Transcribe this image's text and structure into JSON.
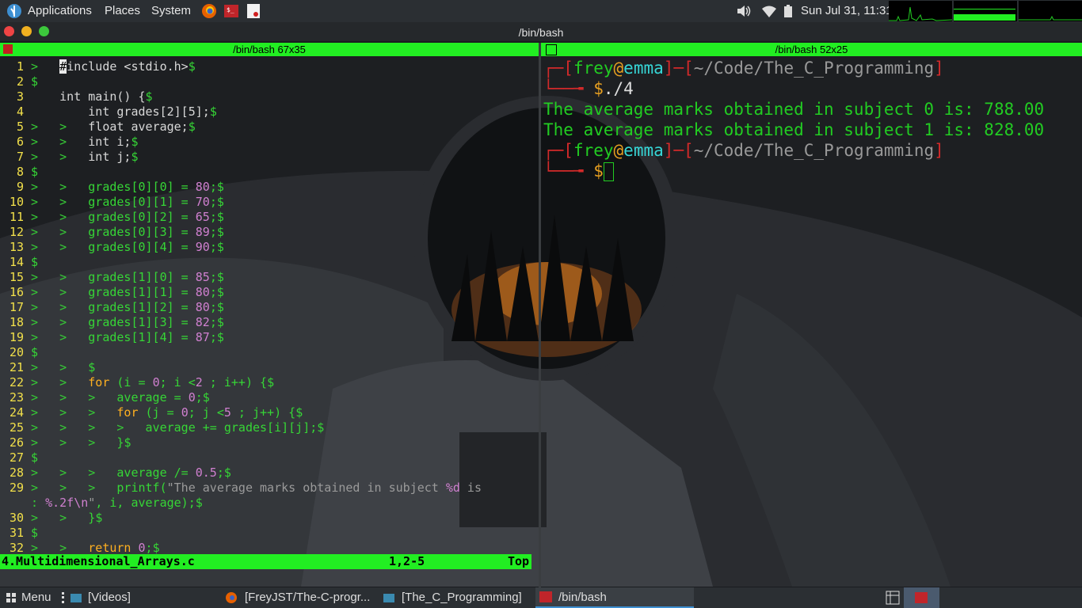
{
  "topbar": {
    "applications": "Applications",
    "places": "Places",
    "system": "System",
    "clock": "Sun Jul 31, 11:31",
    "icons": [
      "distro-logo-icon",
      "firefox-icon",
      "terminal-icon",
      "screenshot-icon",
      "volume-icon",
      "wifi-icon",
      "battery-icon"
    ]
  },
  "window": {
    "title": "/bin/bash"
  },
  "left_pane": {
    "title": "/bin/bash 67x35",
    "lines": [
      {
        "n": "1",
        "ind": "> ",
        "segs": [
          [
            "cur",
            "#"
          ],
          [
            "txt",
            "include <stdio.h>"
          ],
          [
            "dol",
            "$"
          ]
        ],
        "pre": "  "
      },
      {
        "n": "2",
        "ind": "$",
        "segs": [],
        "pre": ""
      },
      {
        "n": "3",
        "ind": "",
        "segs": [
          [
            "txt",
            "int main() {"
          ],
          [
            "dol",
            "$"
          ]
        ],
        "pre": "    "
      },
      {
        "n": "4",
        "ind": "",
        "segs": [
          [
            "txt",
            "int grades[2][5];"
          ],
          [
            "dol",
            "$"
          ]
        ],
        "pre": "        "
      },
      {
        "n": "5",
        "ind": ">   >   ",
        "segs": [
          [
            "txt",
            "float average;"
          ],
          [
            "dol",
            "$"
          ]
        ],
        "pre": ""
      },
      {
        "n": "6",
        "ind": ">   >   ",
        "segs": [
          [
            "txt",
            "int i;"
          ],
          [
            "dol",
            "$"
          ]
        ],
        "pre": ""
      },
      {
        "n": "7",
        "ind": ">   >   ",
        "segs": [
          [
            "txt",
            "int j;"
          ],
          [
            "dol",
            "$"
          ]
        ],
        "pre": ""
      },
      {
        "n": "8",
        "ind": "$",
        "segs": [],
        "pre": ""
      },
      {
        "n": "9",
        "ind": ">   >   ",
        "segs": [
          [
            "grn",
            "grades[0][0] = "
          ],
          [
            "num",
            "80"
          ],
          [
            "grn",
            ";"
          ],
          [
            "dol",
            "$"
          ]
        ],
        "pre": ""
      },
      {
        "n": "10",
        "ind": ">   >   ",
        "segs": [
          [
            "grn",
            "grades[0][1] = "
          ],
          [
            "num",
            "70"
          ],
          [
            "grn",
            ";"
          ],
          [
            "dol",
            "$"
          ]
        ],
        "pre": ""
      },
      {
        "n": "11",
        "ind": ">   >   ",
        "segs": [
          [
            "grn",
            "grades[0][2] = "
          ],
          [
            "num",
            "65"
          ],
          [
            "grn",
            ";"
          ],
          [
            "dol",
            "$"
          ]
        ],
        "pre": ""
      },
      {
        "n": "12",
        "ind": ">   >   ",
        "segs": [
          [
            "grn",
            "grades[0][3] = "
          ],
          [
            "num",
            "89"
          ],
          [
            "grn",
            ";"
          ],
          [
            "dol",
            "$"
          ]
        ],
        "pre": ""
      },
      {
        "n": "13",
        "ind": ">   >   ",
        "segs": [
          [
            "grn",
            "grades[0][4] = "
          ],
          [
            "num",
            "90"
          ],
          [
            "grn",
            ";"
          ],
          [
            "dol",
            "$"
          ]
        ],
        "pre": ""
      },
      {
        "n": "14",
        "ind": "$",
        "segs": [],
        "pre": ""
      },
      {
        "n": "15",
        "ind": ">   >   ",
        "segs": [
          [
            "grn",
            "grades[1][0] = "
          ],
          [
            "num",
            "85"
          ],
          [
            "grn",
            ";"
          ],
          [
            "dol",
            "$"
          ]
        ],
        "pre": ""
      },
      {
        "n": "16",
        "ind": ">   >   ",
        "segs": [
          [
            "grn",
            "grades[1][1] = "
          ],
          [
            "num",
            "80"
          ],
          [
            "grn",
            ";"
          ],
          [
            "dol",
            "$"
          ]
        ],
        "pre": ""
      },
      {
        "n": "17",
        "ind": ">   >   ",
        "segs": [
          [
            "grn",
            "grades[1][2] = "
          ],
          [
            "num",
            "80"
          ],
          [
            "grn",
            ";"
          ],
          [
            "dol",
            "$"
          ]
        ],
        "pre": ""
      },
      {
        "n": "18",
        "ind": ">   >   ",
        "segs": [
          [
            "grn",
            "grades[1][3] = "
          ],
          [
            "num",
            "82"
          ],
          [
            "grn",
            ";"
          ],
          [
            "dol",
            "$"
          ]
        ],
        "pre": ""
      },
      {
        "n": "19",
        "ind": ">   >   ",
        "segs": [
          [
            "grn",
            "grades[1][4] = "
          ],
          [
            "num",
            "87"
          ],
          [
            "grn",
            ";"
          ],
          [
            "dol",
            "$"
          ]
        ],
        "pre": ""
      },
      {
        "n": "20",
        "ind": "$",
        "segs": [],
        "pre": ""
      },
      {
        "n": "21",
        "ind": ">   >   ",
        "segs": [
          [
            "dol",
            "$"
          ]
        ],
        "pre": ""
      },
      {
        "n": "22",
        "ind": ">   >   ",
        "segs": [
          [
            "kw",
            "for"
          ],
          [
            "grn",
            " (i = "
          ],
          [
            "num",
            "0"
          ],
          [
            "grn",
            "; i <"
          ],
          [
            "num",
            "2"
          ],
          [
            "grn",
            " ; i++) {"
          ],
          [
            "dol",
            "$"
          ]
        ],
        "pre": ""
      },
      {
        "n": "23",
        "ind": ">   >   >   ",
        "segs": [
          [
            "grn",
            "average = "
          ],
          [
            "num",
            "0"
          ],
          [
            "grn",
            ";"
          ],
          [
            "dol",
            "$"
          ]
        ],
        "pre": ""
      },
      {
        "n": "24",
        "ind": ">   >   >   ",
        "segs": [
          [
            "kw",
            "for"
          ],
          [
            "grn",
            " (j = "
          ],
          [
            "num",
            "0"
          ],
          [
            "grn",
            "; j <"
          ],
          [
            "num",
            "5"
          ],
          [
            "grn",
            " ; j++) {"
          ],
          [
            "dol",
            "$"
          ]
        ],
        "pre": ""
      },
      {
        "n": "25",
        "ind": ">   >   >   >   ",
        "segs": [
          [
            "grn",
            "average += grades[i][j];"
          ],
          [
            "dol",
            "$"
          ]
        ],
        "pre": ""
      },
      {
        "n": "26",
        "ind": ">   >   >   ",
        "segs": [
          [
            "grn",
            "}"
          ],
          [
            "dol",
            "$"
          ]
        ],
        "pre": ""
      },
      {
        "n": "27",
        "ind": "$",
        "segs": [],
        "pre": ""
      },
      {
        "n": "28",
        "ind": ">   >   >   ",
        "segs": [
          [
            "grn",
            "average /= "
          ],
          [
            "num",
            "0.5"
          ],
          [
            "grn",
            ";"
          ],
          [
            "dol",
            "$"
          ]
        ],
        "pre": ""
      },
      {
        "n": "29",
        "ind": ">   >   >   ",
        "segs": [
          [
            "grn",
            "printf("
          ],
          [
            "str",
            "\"The average marks obtained in subject "
          ],
          [
            "num",
            "%d"
          ],
          [
            "str",
            " is"
          ]
        ],
        "pre": ""
      },
      {
        "n": "",
        "ind": ": ",
        "segs": [
          [
            "num",
            "%.2f\\n"
          ],
          [
            "str",
            "\""
          ],
          [
            "grn",
            ", i, average);"
          ],
          [
            "dol",
            "$"
          ]
        ],
        "pre": ""
      },
      {
        "n": "30",
        "ind": ">   >   ",
        "segs": [
          [
            "grn",
            "}"
          ],
          [
            "dol",
            "$"
          ]
        ],
        "pre": ""
      },
      {
        "n": "31",
        "ind": "$",
        "segs": [],
        "pre": ""
      },
      {
        "n": "32",
        "ind": ">   >   ",
        "segs": [
          [
            "kw",
            "return"
          ],
          [
            "grn",
            " "
          ],
          [
            "num",
            "0"
          ],
          [
            "grn",
            ";"
          ],
          [
            "dol",
            "$"
          ]
        ],
        "pre": ""
      }
    ],
    "status_file": "4.Multidimensional_Arrays.c",
    "status_pos": "1,2-5",
    "status_scroll": "Top"
  },
  "right_pane": {
    "title": "/bin/bash 52x25",
    "prompt_user": "frey",
    "prompt_at": "@",
    "prompt_host": "emma",
    "prompt_path": "~/Code/The_C_Programming",
    "command": "./4",
    "output1": "The average marks obtained in subject 0 is: 788.00",
    "output2": "The average marks obtained in subject 1 is: 828.00",
    "dollar": "$"
  },
  "taskbar": {
    "menu": "Menu",
    "videos": "[Videos]",
    "firefox": "[FreyJST/The-C-progr...",
    "folder": "[The_C_Programming]",
    "terminal": "/bin/bash"
  },
  "colors": {
    "accent_green": "#22ee22",
    "prompt_red": "#d32a2a"
  }
}
